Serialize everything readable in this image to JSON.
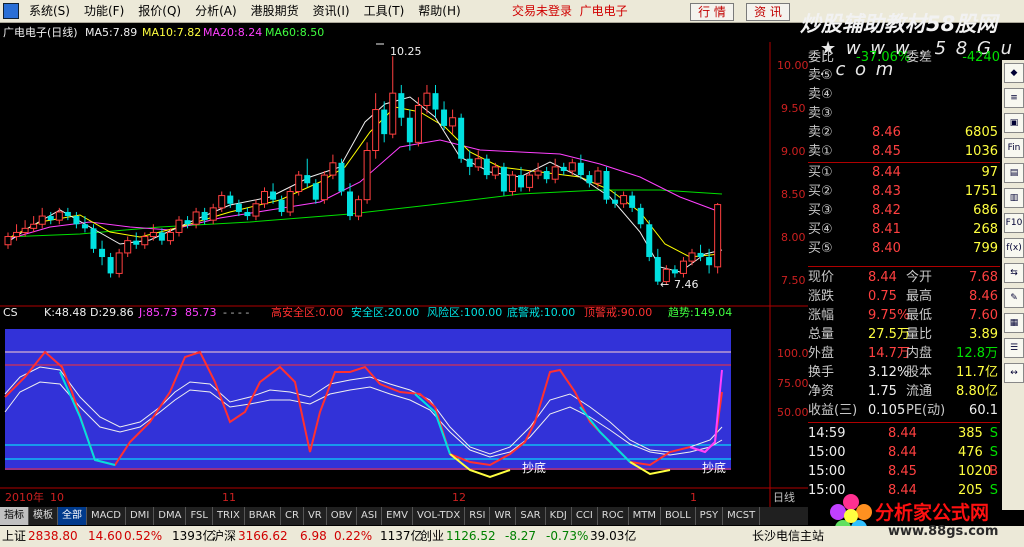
{
  "menu": {
    "items": [
      "系统(S)",
      "功能(F)",
      "报价(Q)",
      "分析(A)",
      "港股期货",
      "资讯(I)",
      "工具(T)",
      "帮助(H)"
    ],
    "center_status": "交易未登录",
    "center_stock": "广电电子",
    "btn_quote": "行 情",
    "btn_news": "资 讯"
  },
  "watermark": {
    "line1": "炒股辅助教材58股网",
    "line2": "★ w w w . 5 8 G u . c o m",
    "line3": "分析家公式网",
    "line4": "www.88gs.com"
  },
  "main_chart": {
    "title": "广电电子(日线)",
    "ma5": "MA5:7.89",
    "ma10": "MA10:7.82",
    "ma20": "MA20:8.24",
    "ma60": "MA60:8.50",
    "high_label": "10.25",
    "low_label": "7.46",
    "y_ticks": [
      "10.00",
      "9.50",
      "9.00",
      "8.50",
      "8.00",
      "7.50"
    ]
  },
  "indicator": {
    "name": "CS",
    "k": "K:48.48",
    "d": "D:29.86",
    "j": "J:85.73",
    "v": "85.73",
    "dots": "- - - -",
    "safe_high": "高安全区:0.00",
    "safe": "安全区:20.00",
    "risk": "风险区:100.00",
    "bottom_warn": "底警戒:10.00",
    "top_warn": "顶警戒:90.00",
    "trend": "趋势:149.04",
    "y_ticks": [
      "100.0",
      "75.00",
      "50.00"
    ],
    "bottom_label_1": "抄底",
    "bottom_label_2": "抄底"
  },
  "x_axis": {
    "labels": [
      "2010年",
      "10",
      "11",
      "12",
      "1"
    ],
    "period": "日线"
  },
  "quote": {
    "row0": {
      "l1": "委比",
      "v1": "-37.06%",
      "l2": "委差",
      "v2": "-4240"
    },
    "sells": [
      {
        "label": "卖⑤",
        "price": "",
        "vol": ""
      },
      {
        "label": "卖④",
        "price": "",
        "vol": ""
      },
      {
        "label": "卖③",
        "price": "",
        "vol": ""
      },
      {
        "label": "卖②",
        "price": "8.46",
        "vol": "6805"
      },
      {
        "label": "卖①",
        "price": "8.45",
        "vol": "1036"
      }
    ],
    "buys": [
      {
        "label": "买①",
        "price": "8.44",
        "vol": "97"
      },
      {
        "label": "买②",
        "price": "8.43",
        "vol": "1751"
      },
      {
        "label": "买③",
        "price": "8.42",
        "vol": "686"
      },
      {
        "label": "买④",
        "price": "8.41",
        "vol": "268"
      },
      {
        "label": "买⑤",
        "price": "8.40",
        "vol": "799"
      }
    ],
    "stats": [
      {
        "l1": "现价",
        "v1": "8.44",
        "l2": "今开",
        "v2": "7.68"
      },
      {
        "l1": "涨跌",
        "v1": "0.75",
        "l2": "最高",
        "v2": "8.46"
      },
      {
        "l1": "涨幅",
        "v1": "9.75%",
        "l2": "最低",
        "v2": "7.60"
      },
      {
        "l1": "总量",
        "v1": "27.5万",
        "l2": "量比",
        "v2": "3.89"
      },
      {
        "l1": "外盘",
        "v1": "14.7万",
        "l2": "内盘",
        "v2": "12.8万"
      },
      {
        "l1": "换手",
        "v1": "3.12%",
        "l2": "股本",
        "v2": "11.7亿"
      },
      {
        "l1": "净资",
        "v1": "1.75",
        "l2": "流通",
        "v2": "8.80亿"
      },
      {
        "l1": "收益(三)",
        "v1": "0.105",
        "l2": "PE(动)",
        "v2": "60.1"
      }
    ],
    "ticks": [
      {
        "t": "14:59",
        "p": "8.44",
        "v": "385",
        "s": "S"
      },
      {
        "t": "15:00",
        "p": "8.44",
        "v": "476",
        "s": "S"
      },
      {
        "t": "15:00",
        "p": "8.45",
        "v": "1020",
        "s": "B"
      },
      {
        "t": "15:00",
        "p": "8.44",
        "v": "205",
        "s": "S"
      }
    ]
  },
  "tabs": [
    "指标",
    "模板",
    "全部",
    "MACD",
    "DMI",
    "DMA",
    "FSL",
    "TRIX",
    "BRAR",
    "CR",
    "VR",
    "OBV",
    "ASI",
    "EMV",
    "VOL-TDX",
    "RSI",
    "WR",
    "SAR",
    "KDJ",
    "CCI",
    "ROC",
    "MTM",
    "BOLL",
    "PSY",
    "MCST"
  ],
  "status": {
    "sh_name": "上证",
    "sh_val": "2838.80",
    "sh_chg": "14.60",
    "sh_pct": "0.52%",
    "sh_amt": "1393亿",
    "sz_name": "沪深",
    "sz_val": "3166.62",
    "sz_chg": "6.98",
    "sz_pct": "0.22%",
    "sz_amt": "1137亿",
    "cy_name": "创业",
    "cy_val": "1126.52",
    "cy_chg": "-8.27",
    "cy_pct": "-0.73%",
    "cy_amt": "39.03亿",
    "broker": "长沙电信主站"
  },
  "colors": {
    "up": "#ff4040",
    "down": "#00e0e0",
    "ma5": "#ffffff",
    "ma10": "#ffff00",
    "ma20": "#ff00ff",
    "ma60": "#00ff00",
    "ind_bg": "#3232d8"
  },
  "chart_data": [
    {
      "type": "candlestick",
      "title": "广电电子(日线)",
      "ylim": [
        7.3,
        10.4
      ],
      "candles": [
        [
          7.95,
          8.05,
          7.9,
          8.1
        ],
        [
          8.05,
          8.1,
          8.0,
          8.2
        ],
        [
          8.1,
          8.15,
          8.05,
          8.25
        ],
        [
          8.15,
          8.2,
          8.1,
          8.3
        ],
        [
          8.2,
          8.3,
          8.15,
          8.4
        ],
        [
          8.3,
          8.25,
          8.2,
          8.35
        ],
        [
          8.25,
          8.35,
          8.2,
          8.4
        ],
        [
          8.35,
          8.3,
          8.25,
          8.4
        ],
        [
          8.3,
          8.2,
          8.15,
          8.35
        ],
        [
          8.2,
          8.15,
          8.1,
          8.3
        ],
        [
          8.15,
          7.9,
          7.85,
          8.2
        ],
        [
          7.9,
          7.8,
          7.7,
          8.0
        ],
        [
          7.8,
          7.6,
          7.55,
          7.85
        ],
        [
          7.6,
          7.85,
          7.55,
          7.9
        ],
        [
          7.85,
          8.0,
          7.8,
          8.05
        ],
        [
          8.0,
          7.95,
          7.9,
          8.1
        ],
        [
          7.95,
          8.05,
          7.9,
          8.1
        ],
        [
          8.05,
          8.1,
          8.0,
          8.2
        ],
        [
          8.1,
          8.0,
          7.95,
          8.15
        ],
        [
          8.0,
          8.1,
          7.95,
          8.15
        ],
        [
          8.1,
          8.25,
          8.05,
          8.3
        ],
        [
          8.25,
          8.2,
          8.15,
          8.3
        ],
        [
          8.2,
          8.35,
          8.15,
          8.4
        ],
        [
          8.35,
          8.25,
          8.2,
          8.4
        ],
        [
          8.25,
          8.4,
          8.2,
          8.45
        ],
        [
          8.4,
          8.55,
          8.35,
          8.6
        ],
        [
          8.55,
          8.45,
          8.4,
          8.6
        ],
        [
          8.45,
          8.35,
          8.3,
          8.5
        ],
        [
          8.35,
          8.3,
          8.25,
          8.4
        ],
        [
          8.3,
          8.45,
          8.25,
          8.5
        ],
        [
          8.45,
          8.6,
          8.4,
          8.65
        ],
        [
          8.6,
          8.5,
          8.45,
          8.7
        ],
        [
          8.5,
          8.35,
          8.3,
          8.55
        ],
        [
          8.35,
          8.6,
          8.3,
          8.65
        ],
        [
          8.6,
          8.8,
          8.55,
          8.85
        ],
        [
          8.8,
          8.7,
          8.65,
          9.0
        ],
        [
          8.7,
          8.5,
          8.45,
          8.75
        ],
        [
          8.5,
          8.8,
          8.45,
          8.85
        ],
        [
          8.8,
          8.95,
          8.75,
          9.05
        ],
        [
          8.95,
          8.6,
          8.55,
          9.0
        ],
        [
          8.6,
          8.3,
          8.25,
          8.7
        ],
        [
          8.3,
          8.5,
          8.25,
          8.55
        ],
        [
          8.5,
          9.1,
          8.45,
          9.2
        ],
        [
          9.1,
          9.6,
          9.0,
          9.8
        ],
        [
          9.6,
          9.3,
          9.2,
          9.7
        ],
        [
          9.3,
          9.8,
          9.25,
          10.25
        ],
        [
          9.8,
          9.5,
          9.4,
          9.9
        ],
        [
          9.5,
          9.2,
          9.1,
          9.6
        ],
        [
          9.2,
          9.65,
          9.15,
          9.75
        ],
        [
          9.65,
          9.8,
          9.55,
          9.9
        ],
        [
          9.8,
          9.6,
          9.5,
          9.9
        ],
        [
          9.6,
          9.4,
          9.35,
          9.7
        ],
        [
          9.4,
          9.5,
          9.3,
          9.6
        ],
        [
          9.5,
          9.0,
          8.95,
          9.55
        ],
        [
          9.0,
          8.9,
          8.8,
          9.1
        ],
        [
          8.9,
          9.0,
          8.85,
          9.1
        ],
        [
          9.0,
          8.8,
          8.75,
          9.05
        ],
        [
          8.8,
          8.9,
          8.75,
          8.95
        ],
        [
          8.9,
          8.6,
          8.55,
          8.95
        ],
        [
          8.6,
          8.8,
          8.55,
          8.85
        ],
        [
          8.8,
          8.65,
          8.6,
          8.9
        ],
        [
          8.65,
          8.8,
          8.6,
          8.85
        ],
        [
          8.8,
          8.85,
          8.75,
          8.95
        ],
        [
          8.85,
          8.75,
          8.7,
          8.9
        ],
        [
          8.75,
          8.9,
          8.7,
          9.0
        ],
        [
          8.9,
          8.85,
          8.8,
          8.95
        ],
        [
          8.85,
          8.95,
          8.8,
          9.0
        ],
        [
          8.95,
          8.8,
          8.75,
          9.05
        ],
        [
          8.8,
          8.7,
          8.65,
          8.85
        ],
        [
          8.7,
          8.85,
          8.65,
          8.9
        ],
        [
          8.85,
          8.5,
          8.45,
          8.9
        ],
        [
          8.5,
          8.45,
          8.4,
          8.6
        ],
        [
          8.45,
          8.55,
          8.4,
          8.6
        ],
        [
          8.55,
          8.4,
          8.35,
          8.6
        ],
        [
          8.4,
          8.2,
          8.15,
          8.45
        ],
        [
          8.2,
          7.8,
          7.75,
          8.25
        ],
        [
          7.8,
          7.5,
          7.46,
          7.9
        ],
        [
          7.5,
          7.65,
          7.46,
          7.7
        ],
        [
          7.65,
          7.6,
          7.55,
          7.7
        ],
        [
          7.6,
          7.75,
          7.55,
          7.8
        ],
        [
          7.75,
          7.85,
          7.7,
          7.9
        ],
        [
          7.85,
          7.8,
          7.75,
          7.95
        ],
        [
          7.8,
          7.7,
          7.6,
          7.9
        ],
        [
          7.68,
          8.44,
          7.6,
          8.46
        ]
      ]
    }
  ]
}
